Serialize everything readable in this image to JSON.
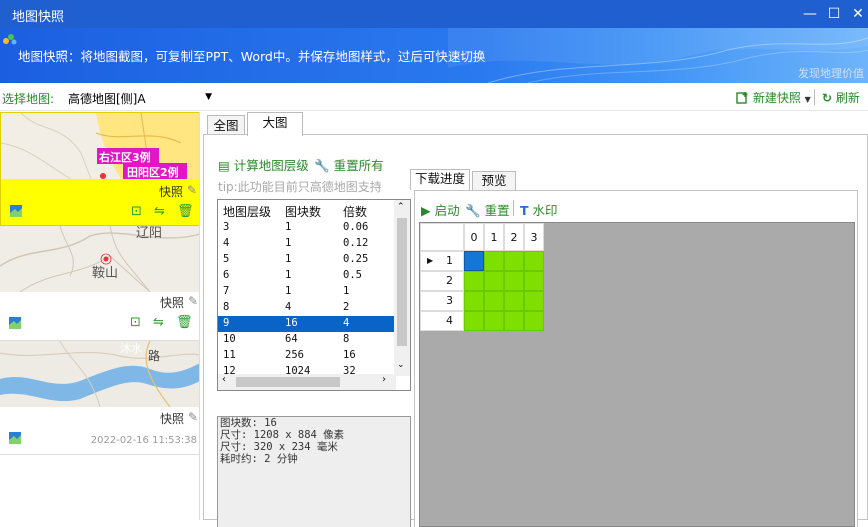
{
  "window": {
    "title": "地图快照"
  },
  "banner": {
    "description": "地图快照：将地图截图，可复制至PPT、Word中。并保存地图样式，过后可快速切换",
    "tagline": "发现地理价值"
  },
  "toolbar": {
    "select_label": "选择地图:",
    "selected_map": "高德地图[侧]A",
    "new_snapshot": "新建快照",
    "refresh": "刷新"
  },
  "snapshots": [
    {
      "label": "快照",
      "map_labels": [
        "右江区3例",
        "田阳区2例"
      ],
      "date": ""
    },
    {
      "label": "快照",
      "map_labels": [
        "辽阳",
        "鞍山"
      ],
      "date": ""
    },
    {
      "label": "快照",
      "map_labels": [
        "沐水",
        "路"
      ],
      "date": "2022-02-16 11:53:38"
    }
  ],
  "tabs": {
    "full": "全图",
    "large": "大图"
  },
  "actions": {
    "calc_levels": "计算地图层级",
    "reset_all": "重置所有"
  },
  "tip": "tip:此功能目前只高德地图支持",
  "levels_table": {
    "headers": [
      "地图层级",
      "图块数",
      "倍数"
    ],
    "rows": [
      [
        "3",
        "1",
        "0.06"
      ],
      [
        "4",
        "1",
        "0.12"
      ],
      [
        "5",
        "1",
        "0.25"
      ],
      [
        "6",
        "1",
        "0.5"
      ],
      [
        "7",
        "1",
        "1"
      ],
      [
        "8",
        "4",
        "2"
      ],
      [
        "9",
        "16",
        "4"
      ],
      [
        "10",
        "64",
        "8"
      ],
      [
        "11",
        "256",
        "16"
      ],
      [
        "12",
        "1024",
        "32"
      ]
    ],
    "selected_level": "9"
  },
  "info": {
    "tiles": "图块数: 16",
    "size_px": "尺寸: 1208 x 884 像素",
    "size_mm": "尺寸: 320 x 234 毫米",
    "time": "耗时约: 2 分钟"
  },
  "sub_tabs": {
    "progress": "下载进度",
    "preview": "预览"
  },
  "progress_actions": {
    "start": "启动",
    "reset": "重置",
    "watermark": "水印"
  },
  "grid": {
    "columns": [
      "0",
      "1",
      "2",
      "3"
    ],
    "rows": [
      "1",
      "2",
      "3",
      "4"
    ],
    "color_done": "#7fe000",
    "color_active": "#1477d6"
  }
}
